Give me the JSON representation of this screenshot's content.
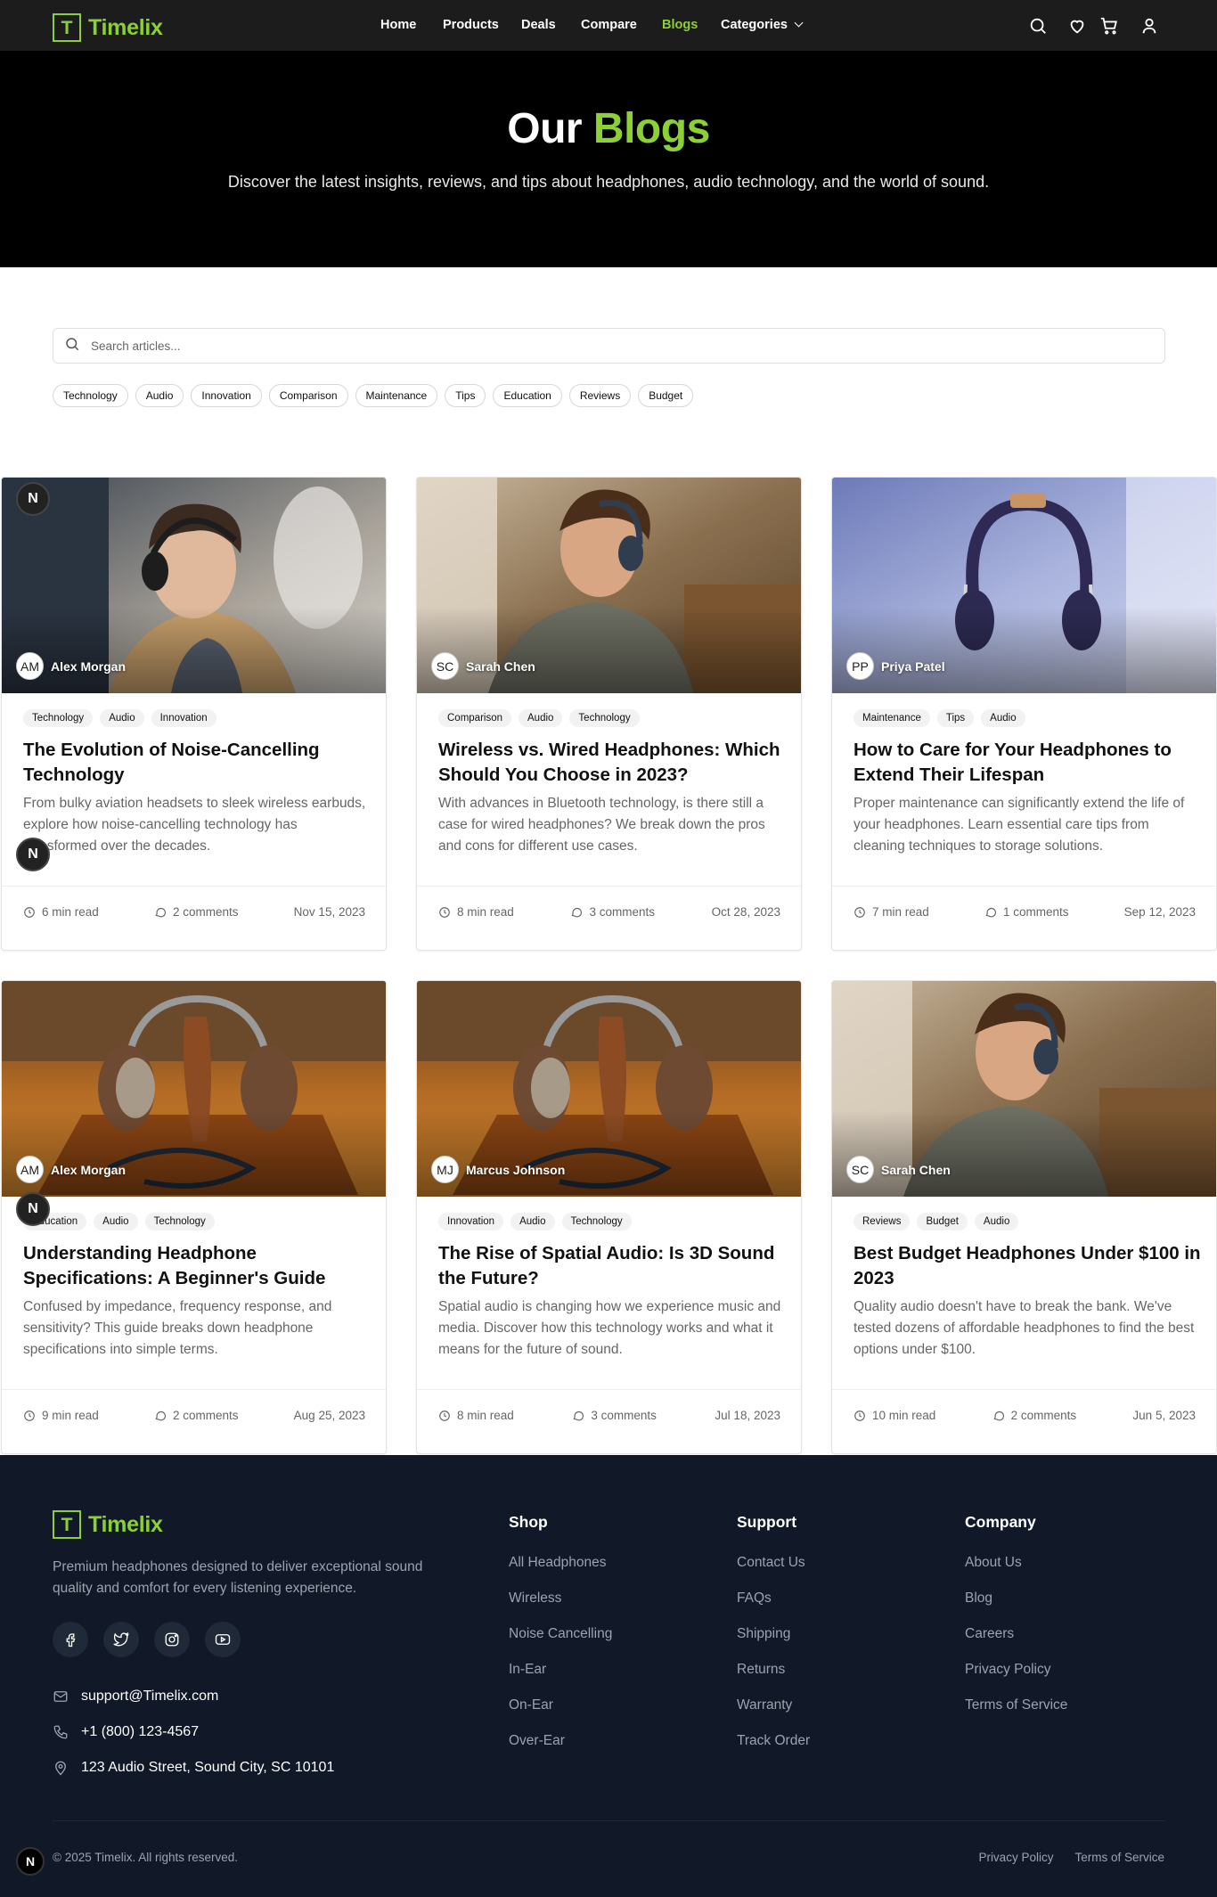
{
  "brand": {
    "letter": "T",
    "name": "Timelix"
  },
  "nav": {
    "home": "Home",
    "products": "Products",
    "deals": "Deals",
    "compare": "Compare",
    "blogs": "Blogs",
    "categories": "Categories"
  },
  "hero": {
    "title_a": "Our",
    "title_b": "Blogs",
    "subtitle": "Discover the latest insights, reviews, and tips about headphones, audio technology, and the world of sound."
  },
  "search": {
    "placeholder": "Search articles..."
  },
  "filter_tags": [
    "Technology",
    "Audio",
    "Innovation",
    "Comparison",
    "Maintenance",
    "Tips",
    "Education",
    "Reviews",
    "Budget"
  ],
  "posts": [
    {
      "author": "Alex Morgan",
      "initials": "AM",
      "tags": [
        "Technology",
        "Audio",
        "Innovation"
      ],
      "title": "The Evolution of Noise-Cancelling Technology",
      "excerpt": "From bulky aviation headsets to sleek wireless earbuds, explore how noise-cancelling technology has transformed over the decades.",
      "read": "6 min read",
      "comments": "2 comments",
      "date": "Nov 15, 2023"
    },
    {
      "author": "Sarah Chen",
      "initials": "SC",
      "tags": [
        "Comparison",
        "Audio",
        "Technology"
      ],
      "title": "Wireless vs. Wired Headphones: Which Should You Choose in 2023?",
      "excerpt": "With advances in Bluetooth technology, is there still a case for wired headphones? We break down the pros and cons for different use cases.",
      "read": "8 min read",
      "comments": "3 comments",
      "date": "Oct 28, 2023"
    },
    {
      "author": "Priya Patel",
      "initials": "PP",
      "tags": [
        "Maintenance",
        "Tips",
        "Audio"
      ],
      "title": "How to Care for Your Headphones to Extend Their Lifespan",
      "excerpt": "Proper maintenance can significantly extend the life of your headphones. Learn essential care tips from cleaning techniques to storage solutions.",
      "read": "7 min read",
      "comments": "1 comments",
      "date": "Sep 12, 2023"
    },
    {
      "author": "Alex Morgan",
      "initials": "AM",
      "tags": [
        "Education",
        "Audio",
        "Technology"
      ],
      "title": "Understanding Headphone Specifications: A Beginner's Guide",
      "excerpt": "Confused by impedance, frequency response, and sensitivity? This guide breaks down headphone specifications into simple terms.",
      "read": "9 min read",
      "comments": "2 comments",
      "date": "Aug 25, 2023"
    },
    {
      "author": "Marcus Johnson",
      "initials": "MJ",
      "tags": [
        "Innovation",
        "Audio",
        "Technology"
      ],
      "title": "The Rise of Spatial Audio: Is 3D Sound the Future?",
      "excerpt": "Spatial audio is changing how we experience music and media. Discover how this technology works and what it means for the future of sound.",
      "read": "8 min read",
      "comments": "3 comments",
      "date": "Jul 18, 2023"
    },
    {
      "author": "Sarah Chen",
      "initials": "SC",
      "tags": [
        "Reviews",
        "Budget",
        "Audio"
      ],
      "title": "Best Budget Headphones Under $100 in 2023",
      "excerpt": "Quality audio doesn't have to break the bank. We've tested dozens of affordable headphones to find the best options under $100.",
      "read": "10 min read",
      "comments": "2 comments",
      "date": "Jun 5, 2023"
    }
  ],
  "footer": {
    "desc": "Premium headphones designed to deliver exceptional sound quality and comfort for every listening experience.",
    "email": "support@Timelix.com",
    "phone": "+1 (800) 123-4567",
    "address": "123 Audio Street, Sound City, SC 10101",
    "cols": [
      {
        "title": "Shop",
        "links": [
          "All Headphones",
          "Wireless",
          "Noise Cancelling",
          "In-Ear",
          "On-Ear",
          "Over-Ear"
        ]
      },
      {
        "title": "Support",
        "links": [
          "Contact Us",
          "FAQs",
          "Shipping",
          "Returns",
          "Warranty",
          "Track Order"
        ]
      },
      {
        "title": "Company",
        "links": [
          "About Us",
          "Blog",
          "Careers",
          "Privacy Policy",
          "Terms of Service"
        ]
      }
    ],
    "copyright": "© 2025 Timelix. All rights reserved.",
    "legal": [
      "Privacy Policy",
      "Terms of Service"
    ]
  },
  "badge_letter": "N",
  "colors": {
    "accent": "#8bd034",
    "footer_bg": "#111827",
    "topbar_bg": "#1c1c1c"
  }
}
